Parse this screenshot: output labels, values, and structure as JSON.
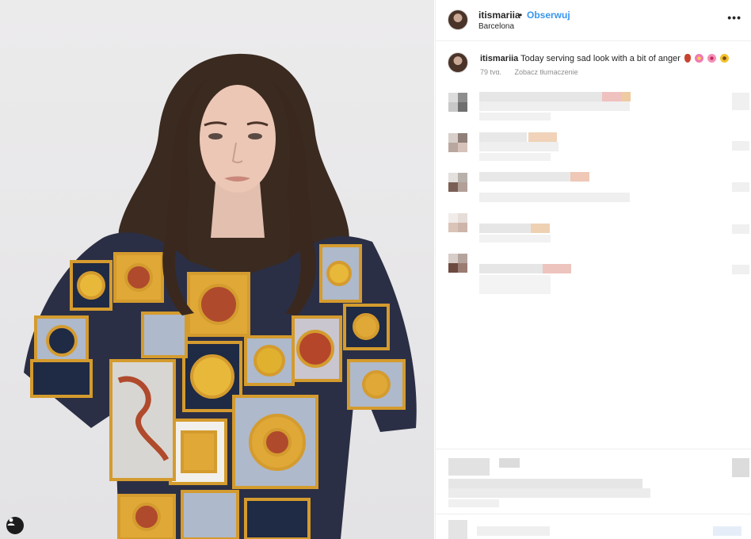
{
  "post": {
    "username": "itismariia",
    "separator": "•",
    "follow_label": "Obserwuj",
    "location": "Barcelona",
    "more_label": "•••"
  },
  "caption": {
    "username": "itismariia",
    "text": "Today serving sad look with a bit of anger",
    "time": "79 tyg.",
    "translate_label": "Zobacz tłumaczenie"
  },
  "colors": {
    "accent": "#3897f0",
    "text": "#262626",
    "muted": "#8e8e8e",
    "divider": "#efefef"
  },
  "icons": {
    "more": "more-options-icon",
    "tag": "user-tag-icon"
  }
}
